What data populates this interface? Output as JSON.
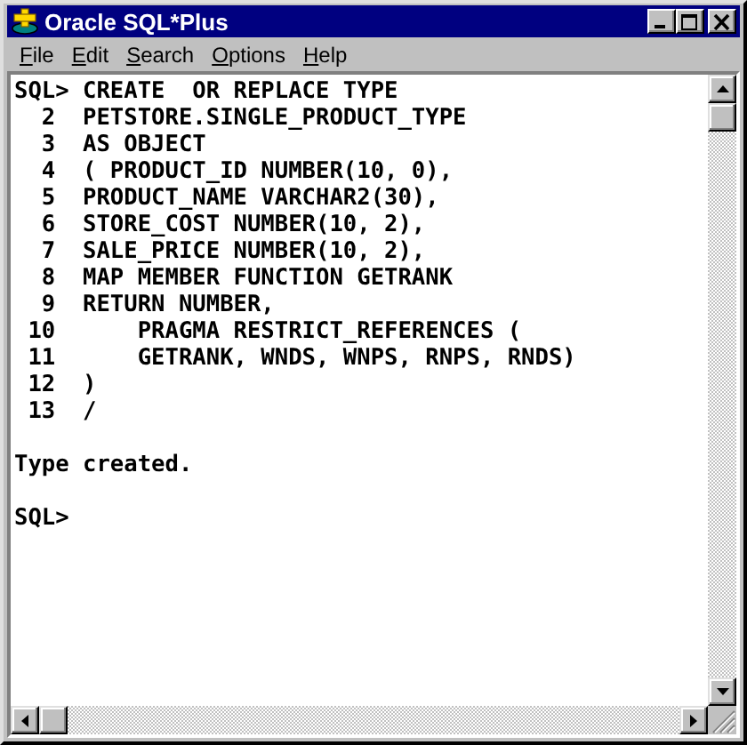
{
  "window": {
    "title": "Oracle SQL*Plus"
  },
  "menu": [
    "File",
    "Edit",
    "Search",
    "Options",
    "Help"
  ],
  "console": [
    {
      "kind": "line",
      "text": "SQL> CREATE  OR REPLACE TYPE"
    },
    {
      "kind": "line",
      "text": "  2  PETSTORE.SINGLE_PRODUCT_TYPE"
    },
    {
      "kind": "line",
      "text": "  3  AS OBJECT"
    },
    {
      "kind": "line",
      "text": "  4  ( PRODUCT_ID NUMBER(10, 0),"
    },
    {
      "kind": "line",
      "text": "  5  PRODUCT_NAME VARCHAR2(30),"
    },
    {
      "kind": "line",
      "text": "  6  STORE_COST NUMBER(10, 2),"
    },
    {
      "kind": "line",
      "text": "  7  SALE_PRICE NUMBER(10, 2),"
    },
    {
      "kind": "line",
      "text": "  8  MAP MEMBER FUNCTION GETRANK"
    },
    {
      "kind": "line",
      "text": "  9  RETURN NUMBER,"
    },
    {
      "kind": "line",
      "text": " 10      PRAGMA RESTRICT_REFERENCES ("
    },
    {
      "kind": "line",
      "text": " 11      GETRANK, WNDS, WNPS, RNPS, RNDS)"
    },
    {
      "kind": "line",
      "text": " 12  )"
    },
    {
      "kind": "line",
      "text": " 13  /"
    },
    {
      "kind": "blank"
    },
    {
      "kind": "line",
      "text": "Type created."
    },
    {
      "kind": "blank"
    },
    {
      "kind": "line",
      "text": "SQL>"
    }
  ]
}
